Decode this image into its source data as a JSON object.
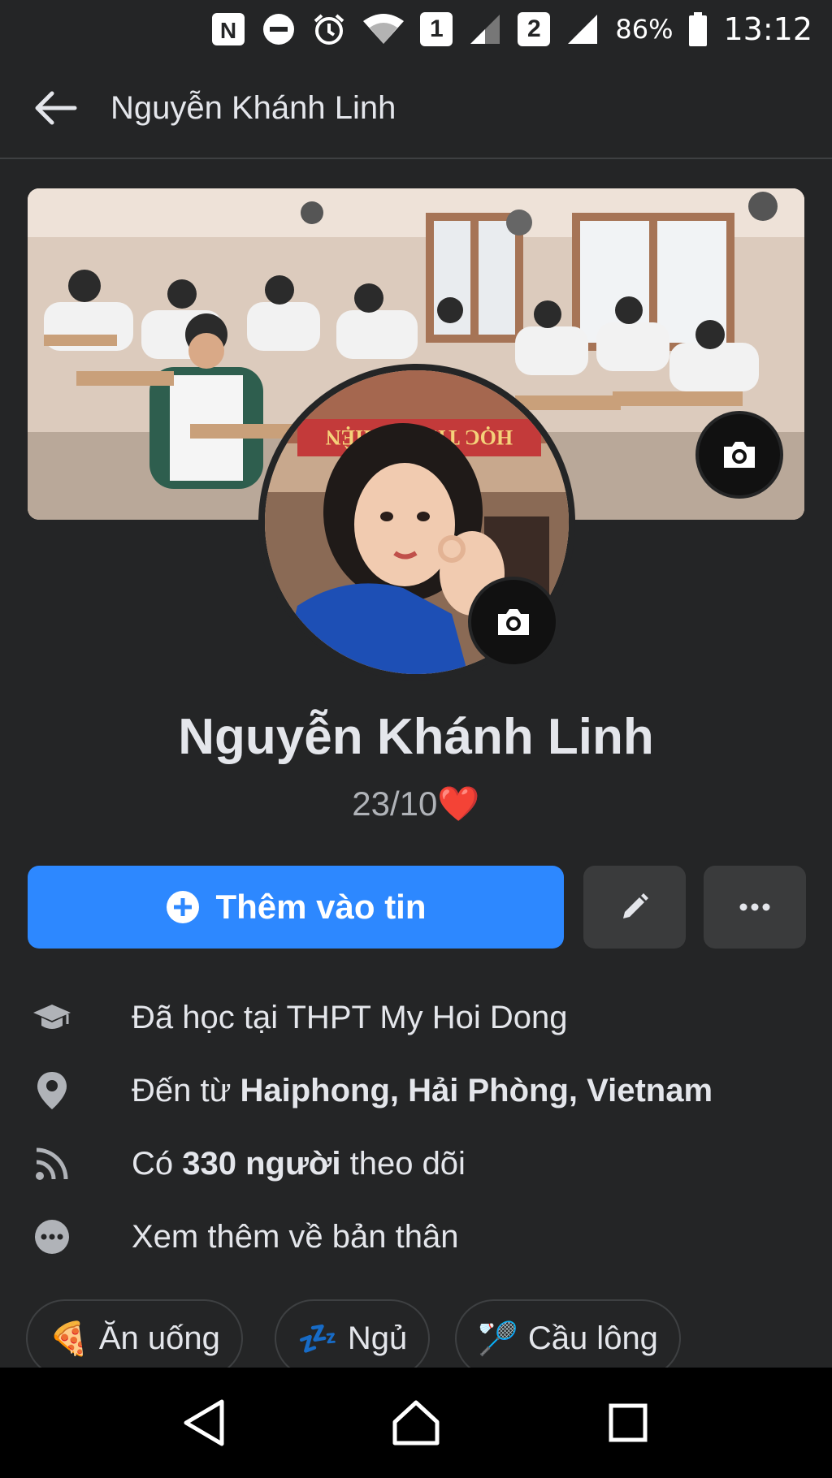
{
  "status_bar": {
    "sim1": "1",
    "sim2": "2",
    "battery": "86%",
    "time": "13:12",
    "icons": [
      "nfc-icon",
      "do-not-disturb-icon",
      "alarm-icon",
      "wifi-icon",
      "signal-icon",
      "battery-icon"
    ]
  },
  "header": {
    "title": "Nguyễn Khánh Linh",
    "back_icon": "arrow-left-icon"
  },
  "cover": {
    "camera_icon": "camera-icon",
    "banner_text": "HỌC THÂN THIỆN"
  },
  "profile": {
    "name": "Nguyễn Khánh Linh",
    "bio": "23/10",
    "bio_emoji": "❤️"
  },
  "actions": {
    "add_story_label": "Thêm vào tin",
    "edit_icon": "pencil-icon",
    "more_icon": "more-icon"
  },
  "info": {
    "education_prefix": "Đã học tại ",
    "education_value": "THPT My Hoi Dong",
    "hometown_prefix": "Đến từ ",
    "hometown_value": "Haiphong, Hải Phòng, Vietnam",
    "followers_prefix": "Có ",
    "followers_value": "330 người",
    "followers_suffix": " theo dõi",
    "see_more": "Xem thêm về bản thân"
  },
  "hobbies": [
    {
      "emoji": "🍕",
      "label": "Ăn uống"
    },
    {
      "emoji": "💤",
      "label": "Ngủ"
    },
    {
      "emoji": "🏸",
      "label": "Cầu lông"
    }
  ],
  "colors": {
    "background": "#242526",
    "primary": "#2d88ff",
    "secondary_button": "#3a3b3c",
    "text": "#e4e6eb",
    "muted": "#b0b3b8"
  }
}
